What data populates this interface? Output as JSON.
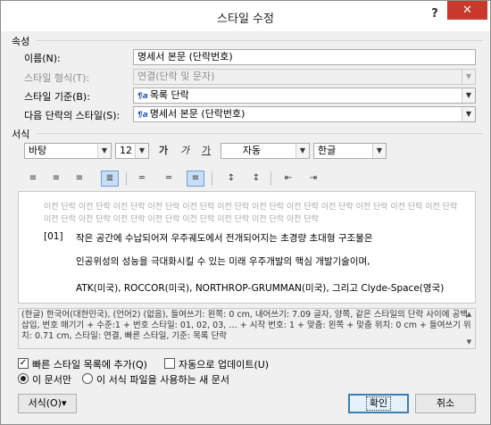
{
  "window": {
    "title": "스타일 수정",
    "help": "?",
    "close": "✕"
  },
  "properties": {
    "section_label": "속성",
    "name_label": "이름(N):",
    "name_value": "명세서 본문 (단락번호)",
    "type_label": "스타일 형식(T):",
    "type_value": "연결(단락 및 문자)",
    "based_label": "스타일 기준(B):",
    "based_value": "목록 단락",
    "next_label": "다음 단락의 스타일(S):",
    "next_value": "명세서 본문 (단락번호)",
    "style_icon": "¶a"
  },
  "formatting": {
    "section_label": "서식",
    "font": "바탕",
    "size": "12",
    "bold": "가",
    "italic": "가",
    "underline": "가",
    "color": "자동",
    "language": "한글"
  },
  "preview": {
    "prev_paragraph": "이전 단락 이전 단락 이전 단락 이전 단락 이전 단락 이전 단락 이전 단락 이전 단락 이전 단락 이전 단락 이전 단락 이전 단락 이전 단락 이전 단락 이전 단락 이전 단락 이전 단락 이전 단락 이전 단락 이전 단락",
    "number": "[01]",
    "line1": "작은 공간에 수납되어져 우주궤도에서 전개되어지는 초경량 초대형 구조물은",
    "line2": "인공위성의 성능을 극대화시킬 수 있는 미래 우주개발의 핵심 개발기술이며,",
    "line3": "ATK(미국), ROCCOR(미국), NORTHROP-GRUMMAN(미국), 그리고 Clyde-Space(영국)"
  },
  "description": "(한글) 한국어(대한민국), (언어2) (없음), 들여쓰기: 왼쪽: 0 cm, 내어쓰기: 7.09 글자, 양쪽, 같은 스타일의 단락 사이에 공백 삽입, 번호 매기기 + 수준:1 + 번호 스타일: 01, 02, 03, … + 시작 번호: 1 + 맞춤: 왼쪽 + 맞춤 위치: 0 cm + 들여쓰기 위치: 0.71 cm, 스타일: 연결, 빠른 스타일, 기준: 목록 단락",
  "options": {
    "quick_style": "빠른 스타일 목록에 추가(Q)",
    "auto_update": "자동으로 업데이트(U)",
    "this_doc": "이 문서만",
    "new_docs": "이 서식 파일을 사용하는 새 문서"
  },
  "buttons": {
    "format": "서식(O)▾",
    "ok": "확인",
    "cancel": "취소"
  }
}
